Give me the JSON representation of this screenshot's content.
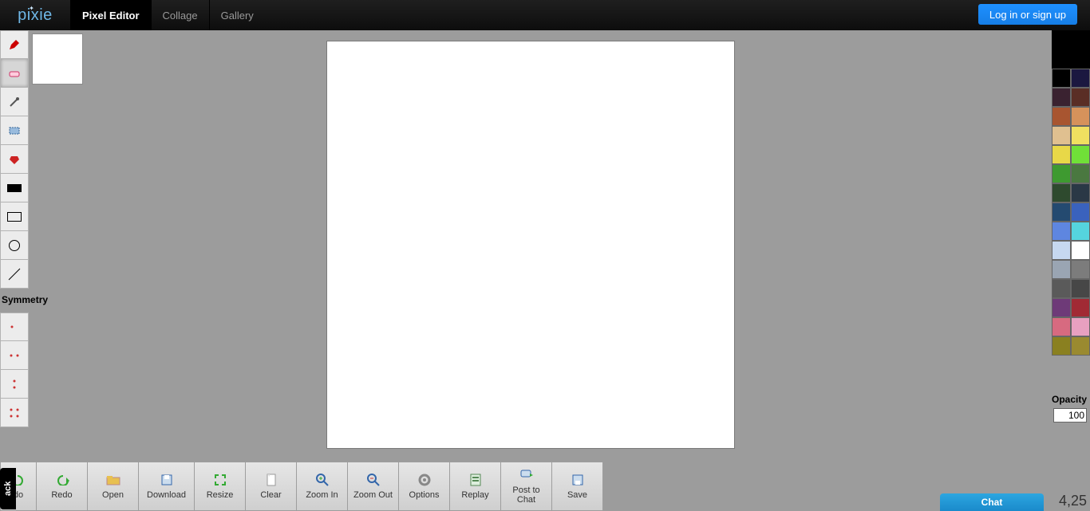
{
  "nav": {
    "logo_text": "pixie",
    "tabs": [
      {
        "label": "Pixel Editor",
        "active": true
      },
      {
        "label": "Collage",
        "active": false
      },
      {
        "label": "Gallery",
        "active": false
      }
    ],
    "login_label": "Log in or sign up"
  },
  "tools": {
    "items": [
      {
        "name": "pencil"
      },
      {
        "name": "eraser",
        "selected": true
      },
      {
        "name": "picker"
      },
      {
        "name": "marquee"
      },
      {
        "name": "bucket"
      },
      {
        "name": "filled-rect"
      },
      {
        "name": "rect-outline"
      },
      {
        "name": "circle-outline"
      },
      {
        "name": "line"
      }
    ],
    "symmetry_label": "Symmetry",
    "symmetry": [
      {
        "name": "sym-none"
      },
      {
        "name": "sym-horizontal"
      },
      {
        "name": "sym-vertical"
      },
      {
        "name": "sym-quad"
      }
    ]
  },
  "palette": {
    "current": "#000000",
    "colors": [
      "#000000",
      "#1b1840",
      "#3a2230",
      "#5a2e25",
      "#a85530",
      "#d6925b",
      "#e0c090",
      "#f0e060",
      "#e8d848",
      "#70e038",
      "#3e9a30",
      "#4a7840",
      "#2e4a2e",
      "#2a3846",
      "#244a70",
      "#3a62bd",
      "#5e86e0",
      "#55d4de",
      "#c6d8f0",
      "#ffffff",
      "#9aa5b3",
      "#7c7c7c",
      "#5a5a5a",
      "#474747",
      "#6e3a78",
      "#a12a34",
      "#d76a80",
      "#e8a0c0",
      "#8a8020",
      "#9a8a30"
    ],
    "opacity_label": "Opacity",
    "opacity_value": "100"
  },
  "actions": [
    {
      "name": "undo",
      "label": "do"
    },
    {
      "name": "redo",
      "label": "Redo"
    },
    {
      "name": "open",
      "label": "Open"
    },
    {
      "name": "download",
      "label": "Download"
    },
    {
      "name": "resize",
      "label": "Resize"
    },
    {
      "name": "clear",
      "label": "Clear"
    },
    {
      "name": "zoomin",
      "label": "Zoom In"
    },
    {
      "name": "zoomout",
      "label": "Zoom Out"
    },
    {
      "name": "options",
      "label": "Options"
    },
    {
      "name": "replay",
      "label": "Replay"
    },
    {
      "name": "post",
      "label": "Post to Chat"
    },
    {
      "name": "save",
      "label": "Save"
    }
  ],
  "misc": {
    "feedback_tab": "ack",
    "chat": "Chat",
    "coords": "4,25"
  }
}
